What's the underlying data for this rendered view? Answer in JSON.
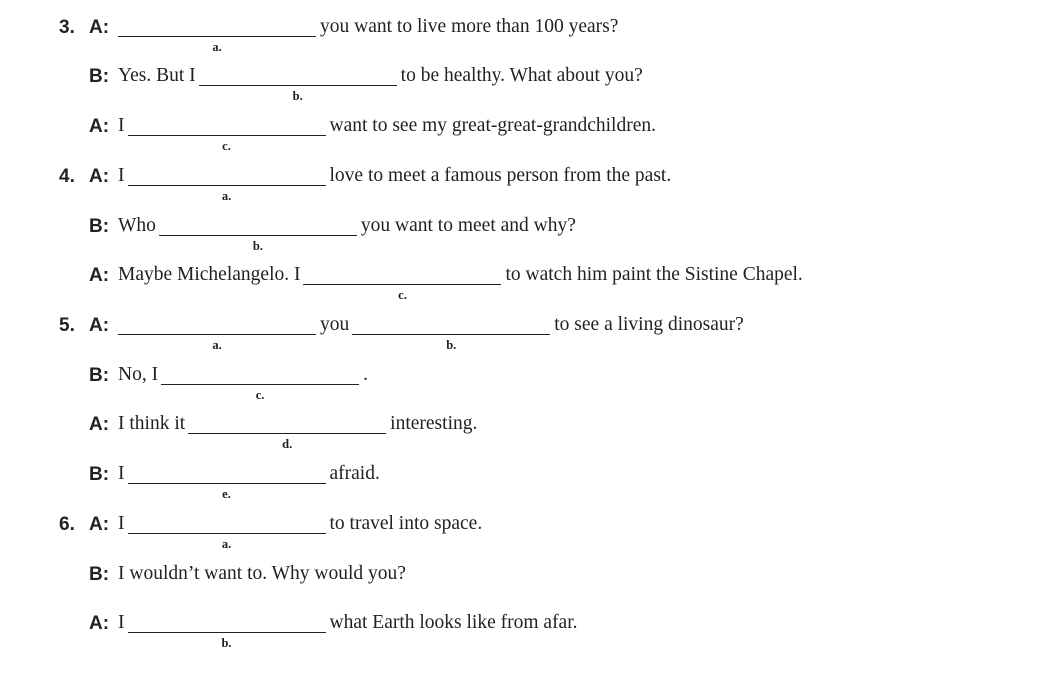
{
  "exercise": {
    "q3": {
      "number": "3.",
      "l1": {
        "speaker": "A:",
        "blank_a": "a.",
        "text": "you want to live more than 100 years?"
      },
      "l2": {
        "speaker": "B:",
        "pre": "Yes. But I",
        "blank_b": "b.",
        "text": "to be healthy. What about you?"
      },
      "l3": {
        "speaker": "A:",
        "pre": "I",
        "blank_c": "c.",
        "text": "want to see my great-great-grandchildren."
      }
    },
    "q4": {
      "number": "4.",
      "l1": {
        "speaker": "A:",
        "pre": "I",
        "blank_a": "a.",
        "text": "love to meet a famous person from the past."
      },
      "l2": {
        "speaker": "B:",
        "pre": "Who",
        "blank_b": "b.",
        "text": "you want to meet and why?"
      },
      "l3": {
        "speaker": "A:",
        "pre": "Maybe Michelangelo. I",
        "blank_c": "c.",
        "text": "to watch him paint the Sistine Chapel."
      }
    },
    "q5": {
      "number": "5.",
      "l1": {
        "speaker": "A:",
        "blank_a": "a.",
        "mid": "you",
        "blank_b": "b.",
        "text": "to see a living dinosaur?"
      },
      "l2": {
        "speaker": "B:",
        "pre": "No, I",
        "blank_c": "c.",
        "text": "."
      },
      "l3": {
        "speaker": "A:",
        "pre": "I think it",
        "blank_d": "d.",
        "text": "interesting."
      },
      "l4": {
        "speaker": "B:",
        "pre": "I",
        "blank_e": "e.",
        "text": "afraid."
      }
    },
    "q6": {
      "number": "6.",
      "l1": {
        "speaker": "A:",
        "pre": "I",
        "blank_a": "a.",
        "text": "to travel into space."
      },
      "l2": {
        "speaker": "B:",
        "text": "I wouldn’t want to. Why would you?"
      },
      "l3": {
        "speaker": "A:",
        "pre": "I",
        "blank_b": "b.",
        "text": "what Earth looks like from afar."
      }
    }
  }
}
